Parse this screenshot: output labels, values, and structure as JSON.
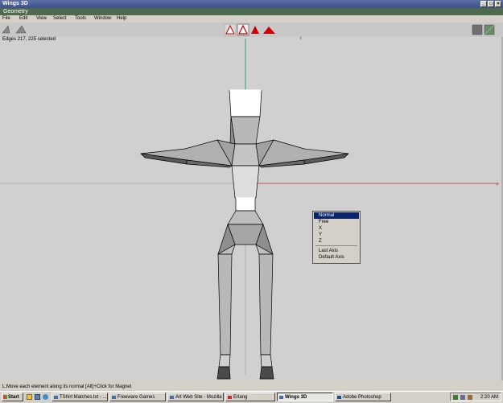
{
  "window": {
    "title": "Wings 3D"
  },
  "geometry_bar": {
    "label": "Geometry"
  },
  "menu": [
    "File",
    "Edit",
    "View",
    "Select",
    "Tools",
    "Window",
    "Help"
  ],
  "info": {
    "text": "Edges 217, 225 selected"
  },
  "context_menu": {
    "items": [
      "Normal",
      "Free",
      "X",
      "Y",
      "Z"
    ],
    "items2": [
      "Last Axis",
      "Default Axis"
    ],
    "selected": "Normal"
  },
  "status": {
    "text": "L:Move each element along its normal   [Alt]+Click for Magnet"
  },
  "taskbar": {
    "start": "Start",
    "tasks": [
      "TShirt Matches.txt - ...",
      "Freeware Games",
      "Art Web Site - Mozilla",
      "Erlang",
      "Wings 3D",
      "Adobe Photoshop"
    ],
    "active": "Wings 3D",
    "clock": "2:20 AM"
  },
  "colors": {
    "title": "#3e5186",
    "geometry_bar": "#4e6a4e",
    "viewport": "#d0d0d0",
    "selected_edge": "#ffffff",
    "red_axis": "#c03030",
    "green_axis": "#30a070",
    "blue_axis": "#4040c0"
  }
}
